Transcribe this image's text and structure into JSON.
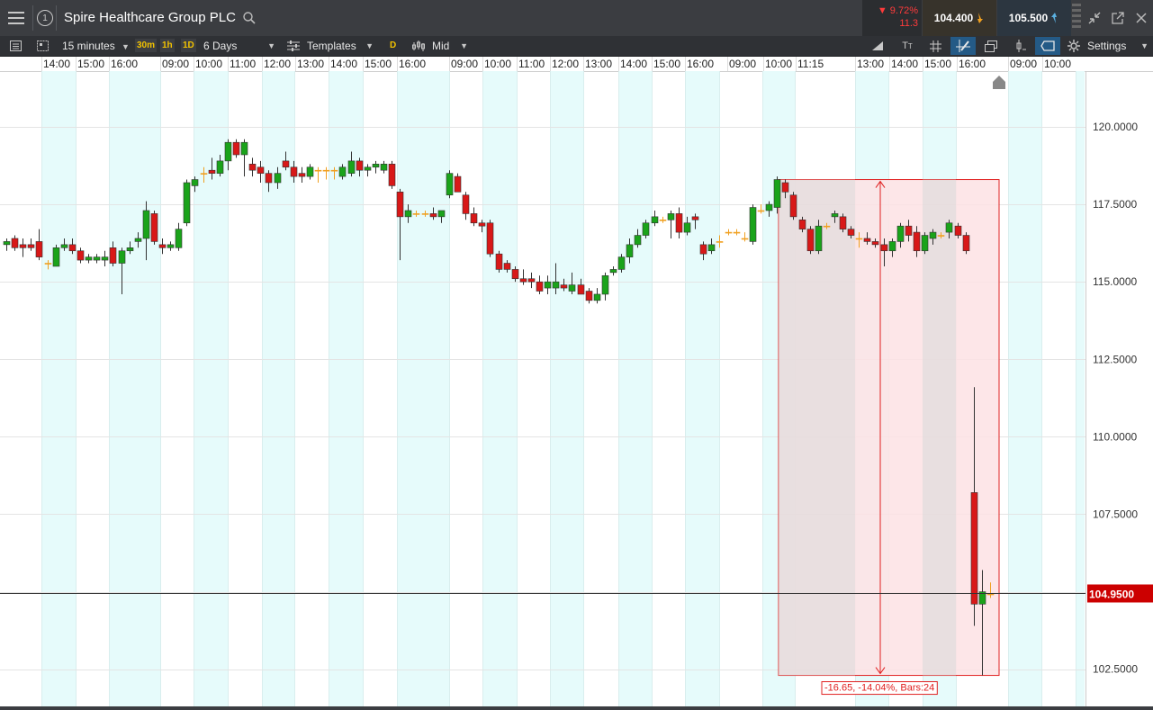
{
  "header": {
    "menu_icon": "hamburger-icon",
    "info_icon": "circled-number-icon",
    "info_number": "1",
    "title": "Spire Healthcare Group PLC",
    "search_icon": "search-icon",
    "change_pct": "▼ 9.72%",
    "change_abs": "11.3",
    "sell_price": "104.400",
    "buy_price": "105.500",
    "sell_color": "#f0a020",
    "buy_color": "#5ab0e0"
  },
  "toolbar": {
    "interval": "15 minutes",
    "quick_intervals": [
      "30m",
      "1h",
      "1D"
    ],
    "range": "6 Days",
    "templates": "Templates",
    "d_badge": "D",
    "price_type": "Mid",
    "settings": "Settings"
  },
  "time_labels": [
    "14:00",
    "15:00",
    "16:00",
    "09:00",
    "10:00",
    "11:00",
    "12:00",
    "13:00",
    "14:00",
    "15:00",
    "16:00",
    "09:00",
    "10:00",
    "11:00",
    "12:00",
    "13:00",
    "14:00",
    "15:00",
    "16:00",
    "09:00",
    "10:00",
    "11:15",
    "13:00",
    "14:00",
    "15:00",
    "16:00",
    "09:00",
    "10:00"
  ],
  "price_axis": {
    "ticks": [
      "120.0000",
      "117.5000",
      "115.0000",
      "112.5000",
      "110.0000",
      "107.5000",
      "104.9500",
      "102.5000"
    ],
    "current_price": "104.9500"
  },
  "measurement": {
    "label": "-16.65, -14.04%, Bars:24",
    "from_price": 118.3,
    "to_price": 102.3
  },
  "colors": {
    "up": "#1aa31a",
    "down": "#d81818",
    "doji": "#f0a020",
    "shade": "#e6fbfb",
    "measure_fill": "#fde2e4",
    "measure_border": "#e02020"
  },
  "chart_data": {
    "type": "candlestick",
    "title": "Spire Healthcare Group PLC",
    "interval": "15 minutes",
    "ylim": [
      101.3,
      121.8
    ],
    "current_price": 104.95,
    "candles": [
      {
        "o": 116.2,
        "h": 116.4,
        "l": 116.0,
        "c": 116.3
      },
      {
        "o": 116.4,
        "h": 116.5,
        "l": 116.0,
        "c": 116.1
      },
      {
        "o": 116.2,
        "h": 116.4,
        "l": 115.8,
        "c": 116.1
      },
      {
        "o": 116.2,
        "h": 116.4,
        "l": 116.0,
        "c": 116.1
      },
      {
        "o": 116.3,
        "h": 116.7,
        "l": 115.7,
        "c": 115.8
      },
      {
        "o": 115.6,
        "h": 115.7,
        "l": 115.4,
        "c": 115.6
      },
      {
        "o": 115.5,
        "h": 116.2,
        "l": 115.5,
        "c": 116.1
      },
      {
        "o": 116.1,
        "h": 116.4,
        "l": 116.0,
        "c": 116.2
      },
      {
        "o": 116.2,
        "h": 116.4,
        "l": 115.9,
        "c": 116.0
      },
      {
        "o": 116.0,
        "h": 116.1,
        "l": 115.6,
        "c": 115.7
      },
      {
        "o": 115.7,
        "h": 115.9,
        "l": 115.6,
        "c": 115.8
      },
      {
        "o": 115.7,
        "h": 115.9,
        "l": 115.6,
        "c": 115.8
      },
      {
        "o": 115.7,
        "h": 116.0,
        "l": 115.5,
        "c": 115.8
      },
      {
        "o": 116.1,
        "h": 116.3,
        "l": 115.5,
        "c": 115.6
      },
      {
        "o": 115.6,
        "h": 116.1,
        "l": 114.6,
        "c": 116.0
      },
      {
        "o": 116.0,
        "h": 116.3,
        "l": 115.9,
        "c": 116.1
      },
      {
        "o": 116.3,
        "h": 116.6,
        "l": 116.1,
        "c": 116.4
      },
      {
        "o": 116.4,
        "h": 117.6,
        "l": 115.7,
        "c": 117.3
      },
      {
        "o": 117.2,
        "h": 117.3,
        "l": 116.2,
        "c": 116.3
      },
      {
        "o": 116.2,
        "h": 116.4,
        "l": 115.9,
        "c": 116.1
      },
      {
        "o": 116.1,
        "h": 116.3,
        "l": 116.0,
        "c": 116.2
      },
      {
        "o": 116.1,
        "h": 116.9,
        "l": 116.0,
        "c": 116.7
      },
      {
        "o": 116.9,
        "h": 118.3,
        "l": 116.8,
        "c": 118.2
      },
      {
        "o": 118.1,
        "h": 118.4,
        "l": 117.9,
        "c": 118.3
      },
      {
        "o": 118.5,
        "h": 118.7,
        "l": 118.2,
        "c": 118.5
      },
      {
        "o": 118.6,
        "h": 119.0,
        "l": 118.3,
        "c": 118.5
      },
      {
        "o": 118.5,
        "h": 119.1,
        "l": 118.4,
        "c": 118.9
      },
      {
        "o": 118.9,
        "h": 119.6,
        "l": 118.6,
        "c": 119.5
      },
      {
        "o": 119.5,
        "h": 119.6,
        "l": 119.0,
        "c": 119.1
      },
      {
        "o": 119.1,
        "h": 119.6,
        "l": 118.4,
        "c": 119.5
      },
      {
        "o": 118.8,
        "h": 119.0,
        "l": 118.4,
        "c": 118.6
      },
      {
        "o": 118.7,
        "h": 118.9,
        "l": 118.2,
        "c": 118.5
      },
      {
        "o": 118.5,
        "h": 118.6,
        "l": 117.9,
        "c": 118.2
      },
      {
        "o": 118.2,
        "h": 118.7,
        "l": 118.0,
        "c": 118.5
      },
      {
        "o": 118.9,
        "h": 119.2,
        "l": 118.6,
        "c": 118.7
      },
      {
        "o": 118.7,
        "h": 118.9,
        "l": 118.2,
        "c": 118.4
      },
      {
        "o": 118.5,
        "h": 118.7,
        "l": 118.2,
        "c": 118.4
      },
      {
        "o": 118.4,
        "h": 118.8,
        "l": 118.3,
        "c": 118.7
      },
      {
        "o": 118.6,
        "h": 118.7,
        "l": 118.2,
        "c": 118.6
      },
      {
        "o": 118.6,
        "h": 118.7,
        "l": 118.3,
        "c": 118.6
      },
      {
        "o": 118.6,
        "h": 118.7,
        "l": 118.3,
        "c": 118.6
      },
      {
        "o": 118.4,
        "h": 118.8,
        "l": 118.3,
        "c": 118.7
      },
      {
        "o": 118.5,
        "h": 119.2,
        "l": 118.4,
        "c": 118.9
      },
      {
        "o": 118.9,
        "h": 119.0,
        "l": 118.4,
        "c": 118.6
      },
      {
        "o": 118.6,
        "h": 118.8,
        "l": 118.4,
        "c": 118.7
      },
      {
        "o": 118.7,
        "h": 118.9,
        "l": 118.5,
        "c": 118.8
      },
      {
        "o": 118.6,
        "h": 118.9,
        "l": 118.5,
        "c": 118.8
      },
      {
        "o": 118.8,
        "h": 118.9,
        "l": 118.0,
        "c": 118.1
      },
      {
        "o": 117.9,
        "h": 118.0,
        "l": 115.7,
        "c": 117.1
      },
      {
        "o": 117.1,
        "h": 117.5,
        "l": 116.9,
        "c": 117.3
      },
      {
        "o": 117.2,
        "h": 117.3,
        "l": 117.1,
        "c": 117.2
      },
      {
        "o": 117.2,
        "h": 117.3,
        "l": 117.1,
        "c": 117.2
      },
      {
        "o": 117.2,
        "h": 117.4,
        "l": 117.0,
        "c": 117.1
      },
      {
        "o": 117.1,
        "h": 117.3,
        "l": 116.9,
        "c": 117.3
      },
      {
        "o": 117.8,
        "h": 118.6,
        "l": 117.7,
        "c": 118.5
      },
      {
        "o": 118.4,
        "h": 118.5,
        "l": 117.9,
        "c": 117.9
      },
      {
        "o": 117.8,
        "h": 117.9,
        "l": 117.0,
        "c": 117.2
      },
      {
        "o": 117.2,
        "h": 117.4,
        "l": 116.8,
        "c": 116.9
      },
      {
        "o": 116.9,
        "h": 117.0,
        "l": 116.6,
        "c": 116.8
      },
      {
        "o": 116.9,
        "h": 117.0,
        "l": 115.8,
        "c": 115.9
      },
      {
        "o": 115.9,
        "h": 116.0,
        "l": 115.3,
        "c": 115.4
      },
      {
        "o": 115.6,
        "h": 115.7,
        "l": 115.3,
        "c": 115.4
      },
      {
        "o": 115.4,
        "h": 115.5,
        "l": 115.0,
        "c": 115.1
      },
      {
        "o": 115.1,
        "h": 115.4,
        "l": 114.9,
        "c": 115.0
      },
      {
        "o": 115.1,
        "h": 115.3,
        "l": 114.8,
        "c": 115.0
      },
      {
        "o": 115.0,
        "h": 115.2,
        "l": 114.6,
        "c": 114.7
      },
      {
        "o": 114.8,
        "h": 115.2,
        "l": 114.6,
        "c": 115.0
      },
      {
        "o": 114.8,
        "h": 115.6,
        "l": 114.6,
        "c": 115.0
      },
      {
        "o": 114.9,
        "h": 115.1,
        "l": 114.7,
        "c": 114.8
      },
      {
        "o": 114.7,
        "h": 115.3,
        "l": 114.6,
        "c": 114.9
      },
      {
        "o": 114.9,
        "h": 115.1,
        "l": 114.6,
        "c": 114.6
      },
      {
        "o": 114.7,
        "h": 114.8,
        "l": 114.3,
        "c": 114.4
      },
      {
        "o": 114.4,
        "h": 114.8,
        "l": 114.3,
        "c": 114.6
      },
      {
        "o": 114.6,
        "h": 115.3,
        "l": 114.4,
        "c": 115.2
      },
      {
        "o": 115.3,
        "h": 115.5,
        "l": 115.2,
        "c": 115.4
      },
      {
        "o": 115.4,
        "h": 115.9,
        "l": 115.3,
        "c": 115.8
      },
      {
        "o": 115.8,
        "h": 116.4,
        "l": 115.6,
        "c": 116.2
      },
      {
        "o": 116.2,
        "h": 116.7,
        "l": 116.1,
        "c": 116.5
      },
      {
        "o": 116.5,
        "h": 117.0,
        "l": 116.4,
        "c": 116.9
      },
      {
        "o": 116.9,
        "h": 117.3,
        "l": 116.8,
        "c": 117.1
      },
      {
        "o": 117.0,
        "h": 117.1,
        "l": 116.9,
        "c": 117.0
      },
      {
        "o": 117.0,
        "h": 117.3,
        "l": 116.4,
        "c": 117.2
      },
      {
        "o": 117.2,
        "h": 117.4,
        "l": 116.4,
        "c": 116.6
      },
      {
        "o": 116.6,
        "h": 117.1,
        "l": 116.5,
        "c": 116.9
      },
      {
        "o": 117.1,
        "h": 117.2,
        "l": 116.7,
        "c": 117.0
      },
      {
        "o": 116.2,
        "h": 116.3,
        "l": 115.7,
        "c": 115.9
      },
      {
        "o": 116.0,
        "h": 116.4,
        "l": 115.9,
        "c": 116.2
      },
      {
        "o": 116.3,
        "h": 116.5,
        "l": 116.1,
        "c": 116.3
      },
      {
        "o": 116.6,
        "h": 116.7,
        "l": 116.5,
        "c": 116.6
      },
      {
        "o": 116.6,
        "h": 116.7,
        "l": 116.5,
        "c": 116.6
      },
      {
        "o": 116.4,
        "h": 116.6,
        "l": 116.3,
        "c": 116.4
      },
      {
        "o": 116.3,
        "h": 117.5,
        "l": 116.2,
        "c": 117.4
      },
      {
        "o": 117.3,
        "h": 117.5,
        "l": 117.2,
        "c": 117.3
      },
      {
        "o": 117.3,
        "h": 117.6,
        "l": 117.1,
        "c": 117.5
      },
      {
        "o": 117.4,
        "h": 118.4,
        "l": 117.2,
        "c": 118.3
      },
      {
        "o": 118.2,
        "h": 118.3,
        "l": 117.7,
        "c": 117.9
      },
      {
        "o": 117.8,
        "h": 117.9,
        "l": 117.0,
        "c": 117.1
      },
      {
        "o": 117.0,
        "h": 117.1,
        "l": 116.6,
        "c": 116.7
      },
      {
        "o": 116.7,
        "h": 116.8,
        "l": 115.9,
        "c": 116.0
      },
      {
        "o": 116.0,
        "h": 117.0,
        "l": 115.9,
        "c": 116.8
      },
      {
        "o": 116.8,
        "h": 116.9,
        "l": 116.7,
        "c": 116.8
      },
      {
        "o": 117.1,
        "h": 117.3,
        "l": 116.9,
        "c": 117.2
      },
      {
        "o": 117.1,
        "h": 117.2,
        "l": 116.6,
        "c": 116.7
      },
      {
        "o": 116.7,
        "h": 116.8,
        "l": 116.4,
        "c": 116.5
      },
      {
        "o": 116.4,
        "h": 116.6,
        "l": 116.1,
        "c": 116.4
      },
      {
        "o": 116.4,
        "h": 116.6,
        "l": 116.2,
        "c": 116.3
      },
      {
        "o": 116.3,
        "h": 116.4,
        "l": 116.1,
        "c": 116.2
      },
      {
        "o": 116.2,
        "h": 116.4,
        "l": 115.5,
        "c": 116.0
      },
      {
        "o": 116.0,
        "h": 116.4,
        "l": 115.8,
        "c": 116.3
      },
      {
        "o": 116.3,
        "h": 116.9,
        "l": 116.1,
        "c": 116.8
      },
      {
        "o": 116.8,
        "h": 117.0,
        "l": 116.3,
        "c": 116.5
      },
      {
        "o": 116.6,
        "h": 116.8,
        "l": 115.8,
        "c": 116.0
      },
      {
        "o": 116.0,
        "h": 116.6,
        "l": 115.9,
        "c": 116.5
      },
      {
        "o": 116.4,
        "h": 116.7,
        "l": 116.2,
        "c": 116.6
      },
      {
        "o": 116.5,
        "h": 116.6,
        "l": 116.4,
        "c": 116.5
      },
      {
        "o": 116.6,
        "h": 117.0,
        "l": 116.4,
        "c": 116.9
      },
      {
        "o": 116.8,
        "h": 116.9,
        "l": 116.4,
        "c": 116.5
      },
      {
        "o": 116.5,
        "h": 116.6,
        "l": 115.9,
        "c": 116.0
      },
      {
        "o": 108.2,
        "h": 111.6,
        "l": 103.9,
        "c": 104.6
      },
      {
        "o": 104.6,
        "h": 105.7,
        "l": 102.3,
        "c": 105.0
      },
      {
        "o": 104.9,
        "h": 105.3,
        "l": 104.8,
        "c": 104.95
      }
    ]
  }
}
